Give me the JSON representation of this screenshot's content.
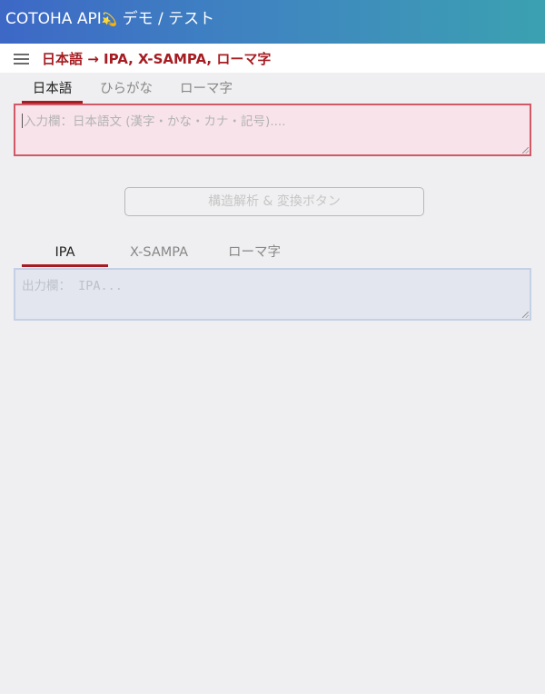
{
  "header": {
    "app_title": "COTOHA API",
    "comet": "💫",
    "subtitle": " デモ / テスト"
  },
  "subheader": {
    "menu_icon": "hamburger-icon",
    "page_title": "日本語 → IPA, X-SAMPA, ローマ字"
  },
  "input_tabs": [
    {
      "label": "日本語",
      "active": true
    },
    {
      "label": "ひらがな",
      "active": false
    },
    {
      "label": "ローマ字",
      "active": false
    }
  ],
  "input": {
    "placeholder": "入力欄：日本語文 (漢字・かな・カナ・記号)....",
    "value": ""
  },
  "convert_button": {
    "label": "構造解析 & 変換ボタン"
  },
  "output_tabs": [
    {
      "label": "IPA",
      "active": true
    },
    {
      "label": "X-SAMPA",
      "active": false
    },
    {
      "label": "ローマ字",
      "active": false
    }
  ],
  "output": {
    "placeholder": "出力欄： IPA...",
    "value": ""
  },
  "colors": {
    "accent": "#a51d22",
    "header_gradient_start": "#3d68c6",
    "header_gradient_end": "#3ba1b1",
    "input_border": "#cf5966",
    "input_bg": "#f8e3ea",
    "output_border": "#c5d0e6",
    "output_bg": "#e3e6ee"
  }
}
